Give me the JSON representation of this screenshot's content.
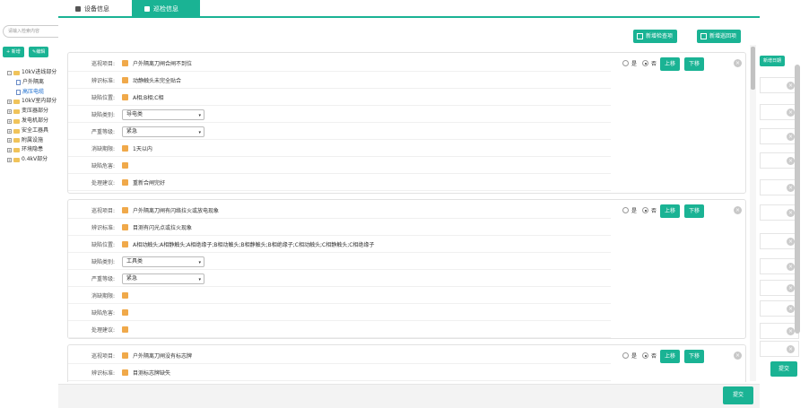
{
  "left_panel": {
    "search_placeholder": "请输入检索内容",
    "add_label": "新增",
    "edit_label": "编辑",
    "tree": [
      {
        "type": "folder",
        "expander": "-",
        "label": "10kV进线部分",
        "active": false
      },
      {
        "type": "file",
        "label": "户外隔离",
        "active": false
      },
      {
        "type": "file",
        "label": "高压电缆",
        "active": true
      },
      {
        "type": "folder",
        "expander": "+",
        "label": "10kV室内部分",
        "active": false
      },
      {
        "type": "folder",
        "expander": "+",
        "label": "变压器部分",
        "active": false
      },
      {
        "type": "folder",
        "expander": "+",
        "label": "发电机部分",
        "active": false
      },
      {
        "type": "folder",
        "expander": "+",
        "label": "安全工器具",
        "active": false
      },
      {
        "type": "folder",
        "expander": "+",
        "label": "附属设施",
        "active": false
      },
      {
        "type": "folder",
        "expander": "+",
        "label": "环境隐患",
        "active": false
      },
      {
        "type": "folder",
        "expander": "+",
        "label": "0.4kV部分",
        "active": false
      }
    ]
  },
  "right_panel": {
    "add_item_label": "新增日期",
    "submit_label": "提交"
  },
  "modal": {
    "tabs": [
      {
        "label": "设备信息",
        "active": false
      },
      {
        "label": "巡检信息",
        "active": true
      }
    ],
    "toolbar": {
      "add_inspect_label": "新增检查项",
      "batch_add_label": "新增巡回项"
    },
    "labels": {
      "item": "巡视项目:",
      "standard": "辨识标准:",
      "position": "缺陷位置:",
      "category": "缺陷类别:",
      "severity": "严重等级:",
      "deadline": "消缺期限:",
      "hazard": "缺陷危害:",
      "suggestion": "处理建议:",
      "yes": "是",
      "no": "否",
      "up": "上移",
      "down": "下移",
      "delete": "×"
    },
    "cards": [
      {
        "item": "户外隔离刀闸合闸不到位",
        "standard": "动静触头未完全贴合",
        "position": "A相;B相;C相",
        "category": "导电类",
        "severity": "紧急",
        "deadline": "1天以内",
        "hazard": "",
        "suggestion": "重新合闸完好"
      },
      {
        "item": "户外隔离刀闸有闪络拉火或放电现象",
        "standard": "目测有闪光点或拉火现象",
        "position": "A相动触头;A相静触头;A相绝缘子;B相动触头;B相静触头;B相绝缘子;C相动触头;C相静触头;C相绝缘子",
        "category": "工具类",
        "severity": "紧急",
        "deadline": "",
        "hazard": "",
        "suggestion": ""
      },
      {
        "item": "户外隔离刀闸没有标志牌",
        "standard": "目测标志牌缺失"
      }
    ],
    "submit_label": "提交"
  }
}
